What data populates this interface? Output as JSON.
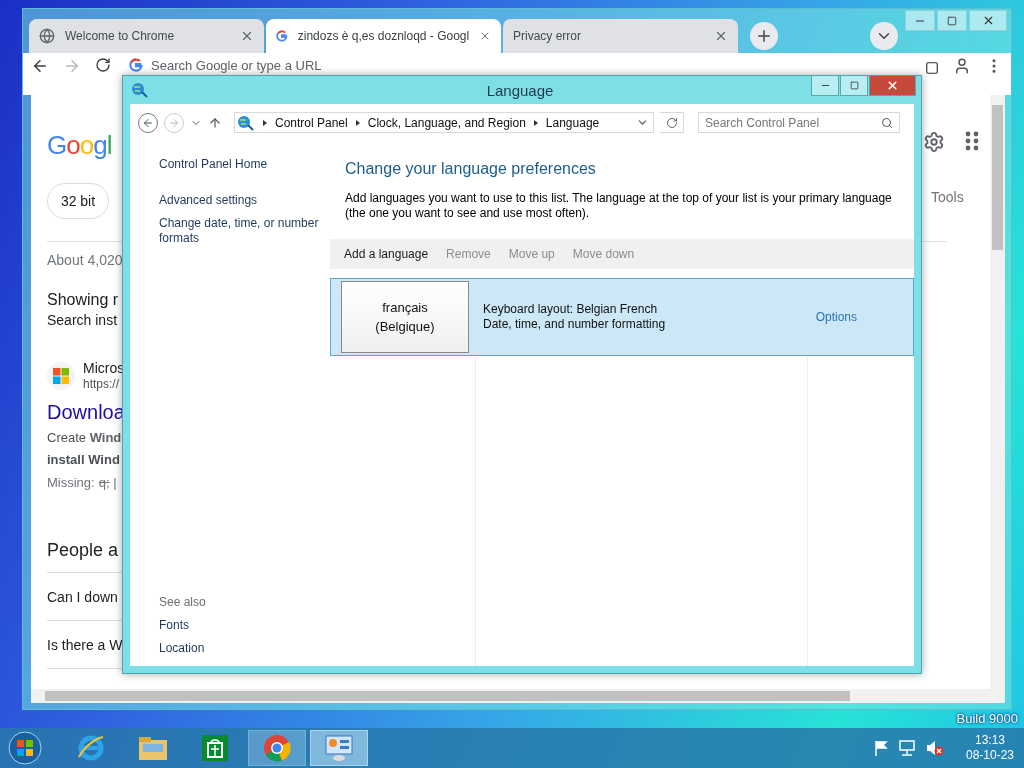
{
  "desktop": {
    "watermark": "Build 9000"
  },
  "browser": {
    "tabs": [
      {
        "title": "Welcome to Chrome",
        "selected": false
      },
      {
        "title": "zindozs è q,es doznloqd - Googl",
        "selected": true
      },
      {
        "title": "Privacy error",
        "selected": false
      }
    ],
    "omnibox": {
      "placeholder": "Search Google or type a URL"
    },
    "page": {
      "logo": "Googl",
      "chips": [
        "32 bit"
      ],
      "tools": "Tools",
      "results": [
        {
          "kind": "stats",
          "text": "About 4,020"
        },
        {
          "kind": "heading",
          "text": "Showing r"
        },
        {
          "kind": "text",
          "text": "Search inst"
        },
        {
          "kind": "source",
          "text": "Micros",
          "url": "https://"
        },
        {
          "kind": "link",
          "text": "Downloa"
        },
        {
          "kind": "snippet",
          "text": "Create **Wind**"
        },
        {
          "kind": "snippet-bold",
          "text": "install Wind"
        },
        {
          "kind": "missing",
          "text": "Missing:",
          "term": "q;",
          "rest": "|"
        },
        {
          "kind": "section",
          "text": "People a"
        },
        {
          "kind": "question",
          "text": "Can I down"
        },
        {
          "kind": "question",
          "text": "Is there a W"
        }
      ]
    }
  },
  "dialog": {
    "title": "Language",
    "breadcrumb": [
      "Control Panel",
      "Clock, Language, and Region",
      "Language"
    ],
    "search": {
      "placeholder": "Search Control Panel"
    },
    "sidebar": {
      "links": [
        "Control Panel Home",
        "Advanced settings",
        "Change date, time, or number formats"
      ],
      "see_also_heading": "See also",
      "see_also": [
        "Fonts",
        "Location"
      ]
    },
    "heading": "Change your language preferences",
    "description": "Add languages you want to use to this list. The language at the top of your list is your primary language (the one you want to see and use most often).",
    "toolbar": [
      {
        "label": "Add a language",
        "disabled": false
      },
      {
        "label": "Remove",
        "disabled": true
      },
      {
        "label": "Move up",
        "disabled": true
      },
      {
        "label": "Move down",
        "disabled": true
      }
    ],
    "languages": [
      {
        "name": "français",
        "region": "(Belgique)",
        "details": [
          "Keyboard layout: Belgian French",
          "Date, time, and number formatting"
        ],
        "options": "Options",
        "selected": true
      }
    ]
  },
  "taskbar": {
    "apps": [
      {
        "kind": "ie",
        "running": false,
        "selected": false
      },
      {
        "kind": "explorer",
        "running": false,
        "selected": false
      },
      {
        "kind": "store",
        "running": false,
        "selected": false
      },
      {
        "kind": "chrome",
        "running": true,
        "selected": false
      },
      {
        "kind": "control-panel",
        "running": true,
        "selected": true
      }
    ],
    "clock": {
      "time": "13:13",
      "date": "08-10-23"
    }
  }
}
